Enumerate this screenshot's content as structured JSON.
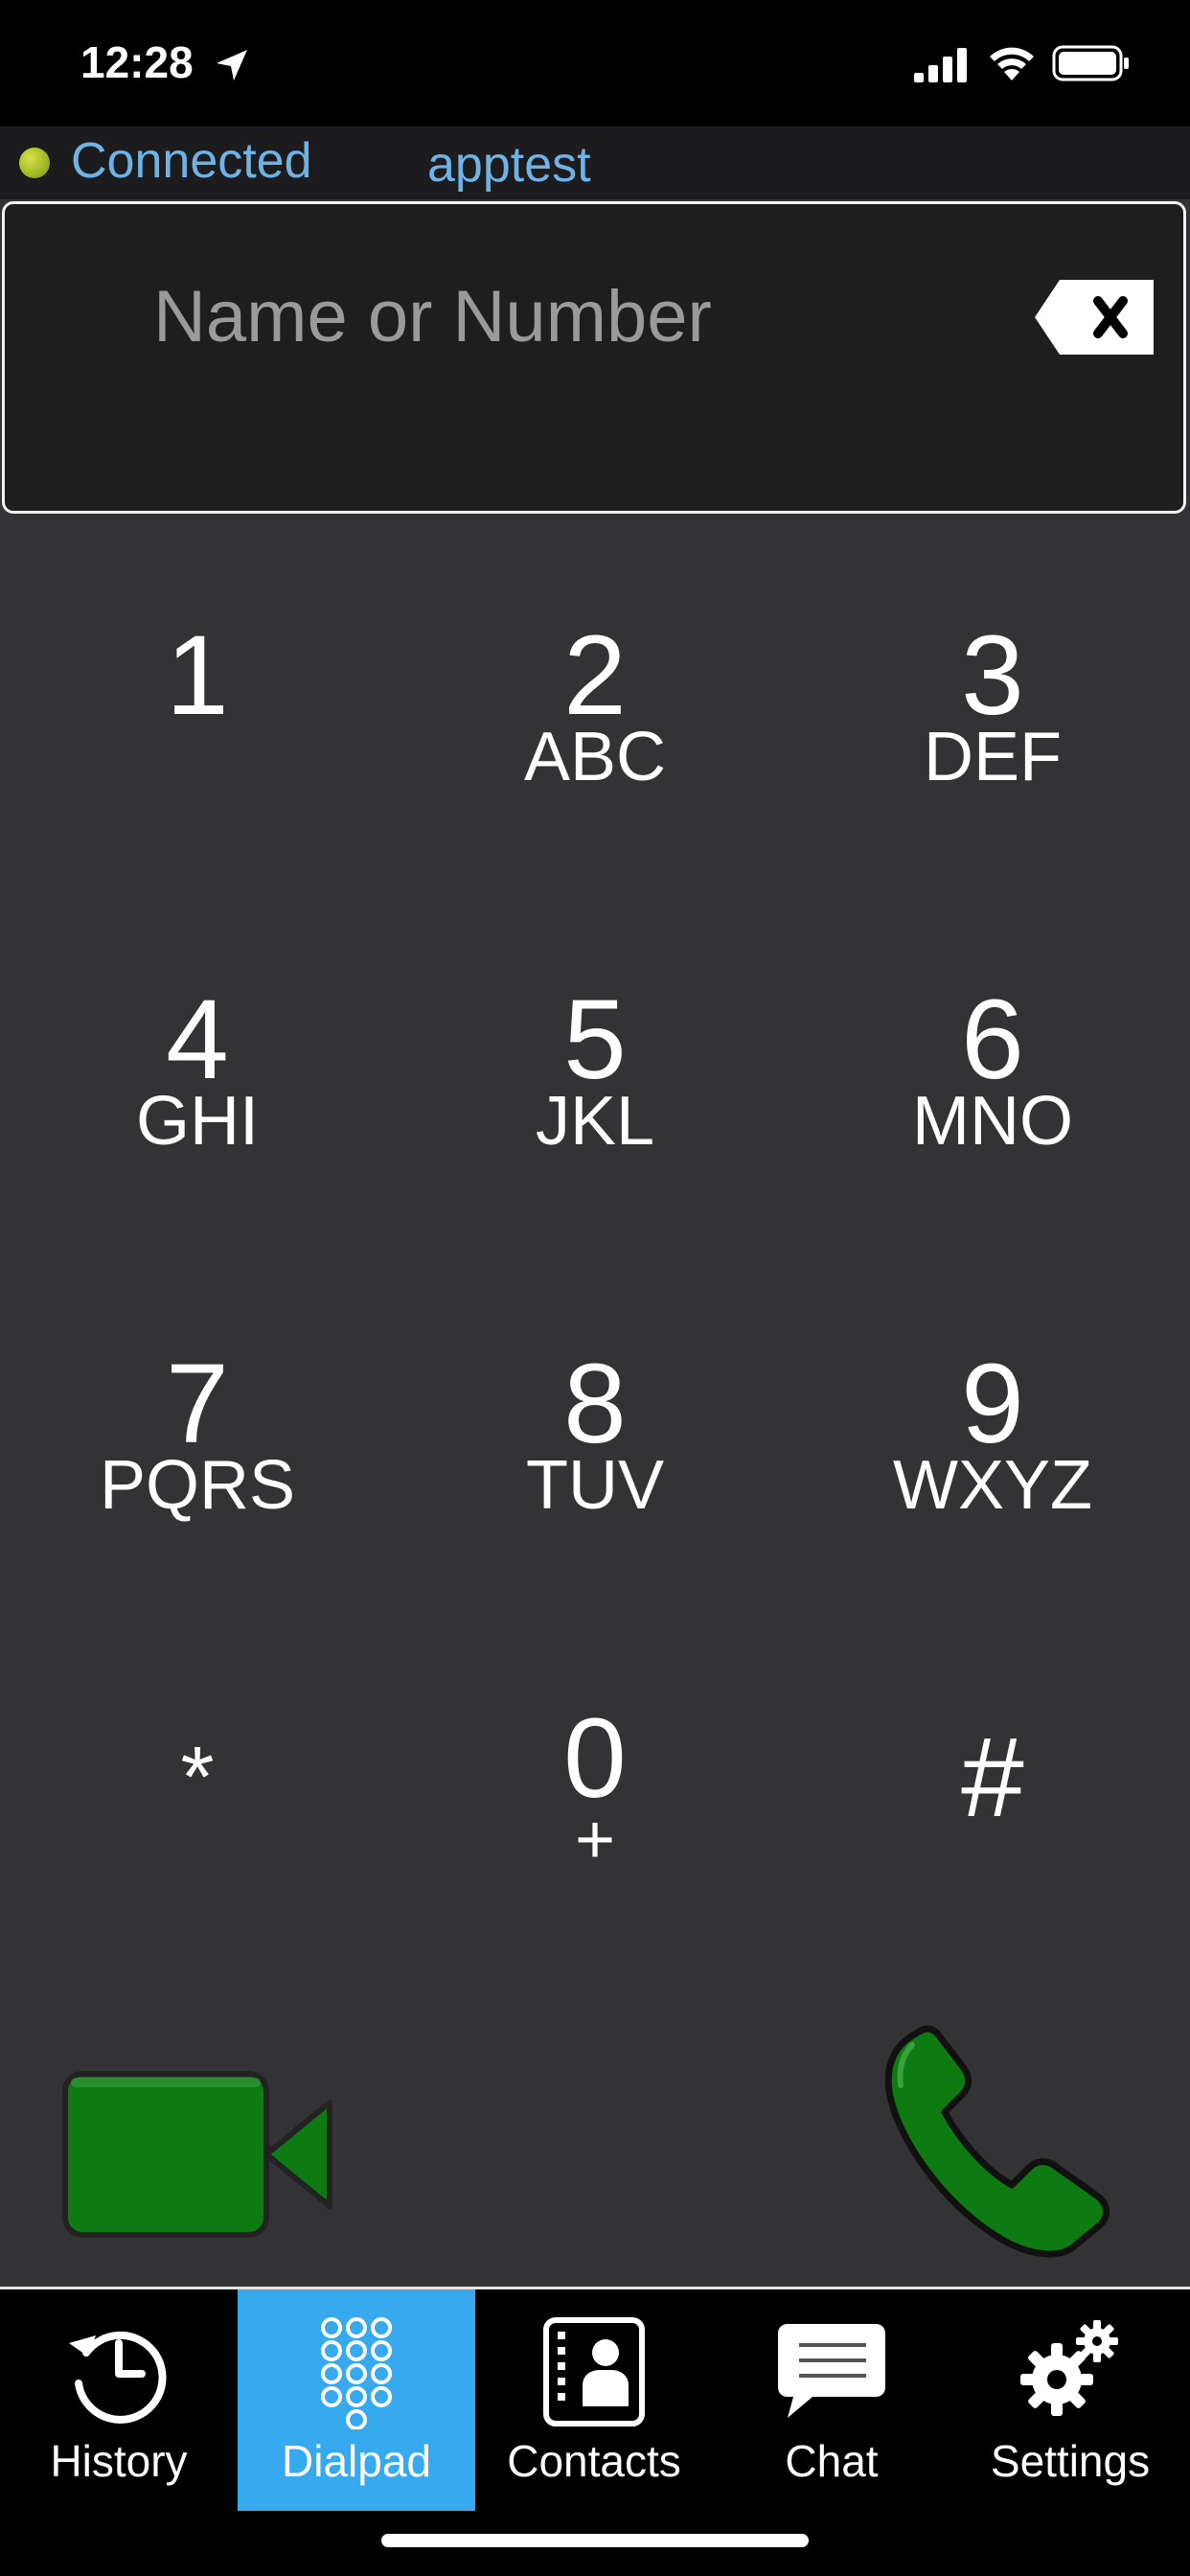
{
  "status_bar": {
    "time": "12:28",
    "location_icon": "location-arrow-icon",
    "signal_icon": "cellular-signal-icon",
    "wifi_icon": "wifi-icon",
    "battery_icon": "battery-icon"
  },
  "connection": {
    "status": "Connected",
    "status_color": "#9fbf1f",
    "account": "apptest",
    "text_color": "#6fb2e6"
  },
  "search": {
    "value": "",
    "placeholder": "Name or Number"
  },
  "dialpad": {
    "keys": [
      {
        "digit": "1",
        "letters": ""
      },
      {
        "digit": "2",
        "letters": "ABC"
      },
      {
        "digit": "3",
        "letters": "DEF"
      },
      {
        "digit": "4",
        "letters": "GHI"
      },
      {
        "digit": "5",
        "letters": "JKL"
      },
      {
        "digit": "6",
        "letters": "MNO"
      },
      {
        "digit": "7",
        "letters": "PQRS"
      },
      {
        "digit": "8",
        "letters": "TUV"
      },
      {
        "digit": "9",
        "letters": "WXYZ"
      },
      {
        "digit": "*",
        "letters": ""
      },
      {
        "digit": "0",
        "letters": "+"
      },
      {
        "digit": "#",
        "letters": ""
      }
    ]
  },
  "actions": {
    "video_icon": "video-camera-icon",
    "call_icon": "phone-icon",
    "accent": "#0d7a12"
  },
  "tabs": [
    {
      "label": "History",
      "icon": "history-clock-icon",
      "active": false
    },
    {
      "label": "Dialpad",
      "icon": "dialpad-icon",
      "active": true
    },
    {
      "label": "Contacts",
      "icon": "contacts-icon",
      "active": false
    },
    {
      "label": "Chat",
      "icon": "chat-bubble-icon",
      "active": false
    },
    {
      "label": "Settings",
      "icon": "gears-icon",
      "active": false
    }
  ],
  "colors": {
    "active_tab": "#37a9ee",
    "background": "#333335"
  }
}
